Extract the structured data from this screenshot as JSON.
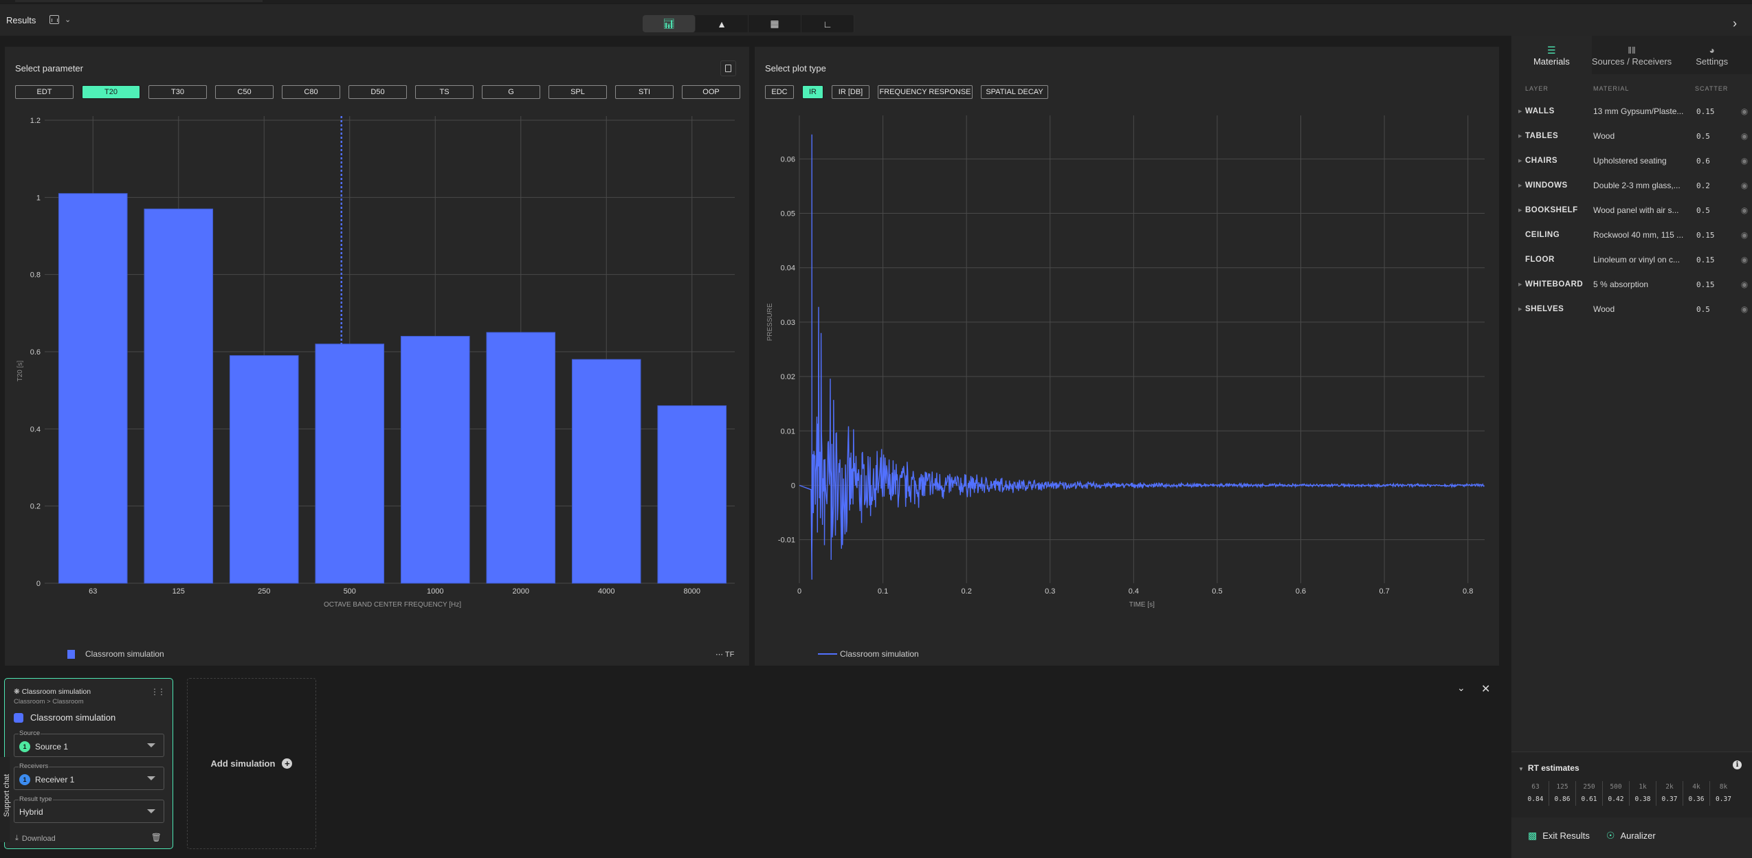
{
  "header": {
    "title": "Results",
    "view_tabs": [
      {
        "name": "results-view",
        "icon": "bar-chart-icon",
        "active": true
      },
      {
        "name": "model-view",
        "icon": "rocket-icon",
        "active": false
      },
      {
        "name": "floorplan-view",
        "icon": "grid-icon",
        "active": false
      },
      {
        "name": "graph-view",
        "icon": "line-chart-icon",
        "active": false
      }
    ]
  },
  "parameter_panel": {
    "title": "Select parameter",
    "parameters": [
      "EDT",
      "T20",
      "T30",
      "C50",
      "C80",
      "D50",
      "TS",
      "G",
      "SPL",
      "STI",
      "OOP"
    ],
    "selected": "T20",
    "legend_label": "Classroom simulation",
    "tf_label": "TF"
  },
  "plot_panel": {
    "title": "Select plot type",
    "plot_types": [
      "EDC",
      "IR",
      "IR [DB]",
      "FREQUENCY RESPONSE",
      "SPATIAL DECAY"
    ],
    "selected": "IR",
    "legend_label": "Classroom simulation"
  },
  "chart_data": [
    {
      "type": "bar",
      "title": "",
      "xlabel": "OCTAVE BAND CENTER FREQUENCY [Hz]",
      "ylabel": "T20 [s]",
      "categories": [
        "63",
        "125",
        "250",
        "500",
        "1000",
        "2000",
        "4000",
        "8000"
      ],
      "series": [
        {
          "name": "Classroom simulation",
          "values": [
            1.01,
            0.97,
            0.59,
            0.62,
            0.64,
            0.65,
            0.58,
            0.46
          ]
        }
      ],
      "ylim": [
        0,
        1.2
      ],
      "yticks": [
        0,
        0.2,
        0.4,
        0.6,
        0.8,
        1,
        1.2
      ],
      "ytick_labels": [
        "0",
        "0.2",
        "0.4",
        "0.6",
        "0.8",
        "1",
        "1.2"
      ],
      "grid": true,
      "legend": "bottom-left",
      "hover_marker_category": "500",
      "color": "#5271ff"
    },
    {
      "type": "line",
      "title": "",
      "xlabel": "TIME [s]",
      "ylabel": "PRESSURE",
      "xlim": [
        0,
        0.82
      ],
      "ylim": [
        -0.018,
        0.068
      ],
      "xticks": [
        0,
        0.1,
        0.2,
        0.3,
        0.4,
        0.5,
        0.6,
        0.7,
        0.8
      ],
      "yticks": [
        -0.01,
        0,
        0.01,
        0.02,
        0.03,
        0.04,
        0.05,
        0.06
      ],
      "series": [
        {
          "name": "Classroom simulation",
          "description": "Impulse response: direct sound peak at ~0.015 s, early reflections decaying to ~0 by 0.4 s",
          "peaks": [
            {
              "x": 0.015,
              "y": 0.0645
            },
            {
              "x": 0.015,
              "y": -0.0125
            },
            {
              "x": 0.023,
              "y": 0.0328
            },
            {
              "x": 0.026,
              "y": 0.028
            },
            {
              "x": 0.037,
              "y": 0.0196
            },
            {
              "x": 0.041,
              "y": 0.0157
            },
            {
              "x": 0.038,
              "y": -0.0137
            },
            {
              "x": 0.03,
              "y": -0.011
            }
          ],
          "envelope_decay_time": 0.09,
          "envelope_initial": 0.012
        }
      ],
      "grid": true,
      "legend": "bottom-left",
      "color": "#5271ff"
    }
  ],
  "sidebar": {
    "tabs": [
      {
        "label": "Materials",
        "icon": "layers-icon",
        "active": true
      },
      {
        "label": "Sources / Receivers",
        "icon": "waveform-icon",
        "active": false
      },
      {
        "label": "Settings",
        "icon": "gauge-icon",
        "active": false
      }
    ],
    "columns": [
      "LAYER",
      "MATERIAL",
      "SCATTER"
    ],
    "materials": [
      {
        "layer": "WALLS",
        "material": "13 mm Gypsum/Plaste...",
        "scatter": "0.15",
        "expandable": true
      },
      {
        "layer": "TABLES",
        "material": "Wood",
        "scatter": "0.5",
        "expandable": true
      },
      {
        "layer": "CHAIRS",
        "material": "Upholstered seating",
        "scatter": "0.6",
        "expandable": true
      },
      {
        "layer": "WINDOWS",
        "material": "Double 2-3 mm glass,...",
        "scatter": "0.2",
        "expandable": true
      },
      {
        "layer": "BOOKSHELF",
        "material": "Wood panel with air s...",
        "scatter": "0.5",
        "expandable": true
      },
      {
        "layer": "CEILING",
        "material": "Rockwool 40 mm, 115 ...",
        "scatter": "0.15",
        "expandable": false
      },
      {
        "layer": "FLOOR",
        "material": "Linoleum or vinyl on c...",
        "scatter": "0.15",
        "expandable": false
      },
      {
        "layer": "WHITEBOARD",
        "material": "5 % absorption",
        "scatter": "0.15",
        "expandable": true
      },
      {
        "layer": "SHELVES",
        "material": "Wood",
        "scatter": "0.5",
        "expandable": true
      }
    ],
    "rt_estimates": {
      "title": "RT estimates",
      "bands": [
        "63",
        "125",
        "250",
        "500",
        "1k",
        "2k",
        "4k",
        "8k"
      ],
      "values": [
        "0.84",
        "0.86",
        "0.61",
        "0.42",
        "0.38",
        "0.37",
        "0.36",
        "0.37"
      ]
    },
    "actions": {
      "exit_results": "Exit Results",
      "auralizer": "Auralizer"
    }
  },
  "simulation_card": {
    "title": "Classroom simulation",
    "breadcrumb": "Classroom > Classroom",
    "name": "Classroom simulation",
    "color": "#5271ff",
    "source": {
      "label": "Source",
      "value": "Source 1",
      "badge": "1",
      "badge_color": "#4ee8a0"
    },
    "receivers": {
      "label": "Receivers",
      "value": "Receiver 1",
      "badge": "1",
      "badge_color": "#3c8cf0"
    },
    "result_type": {
      "label": "Result type",
      "value": "Hybrid"
    },
    "download_label": "Download"
  },
  "add_simulation_label": "Add simulation",
  "support_chat_label": "Support chat"
}
